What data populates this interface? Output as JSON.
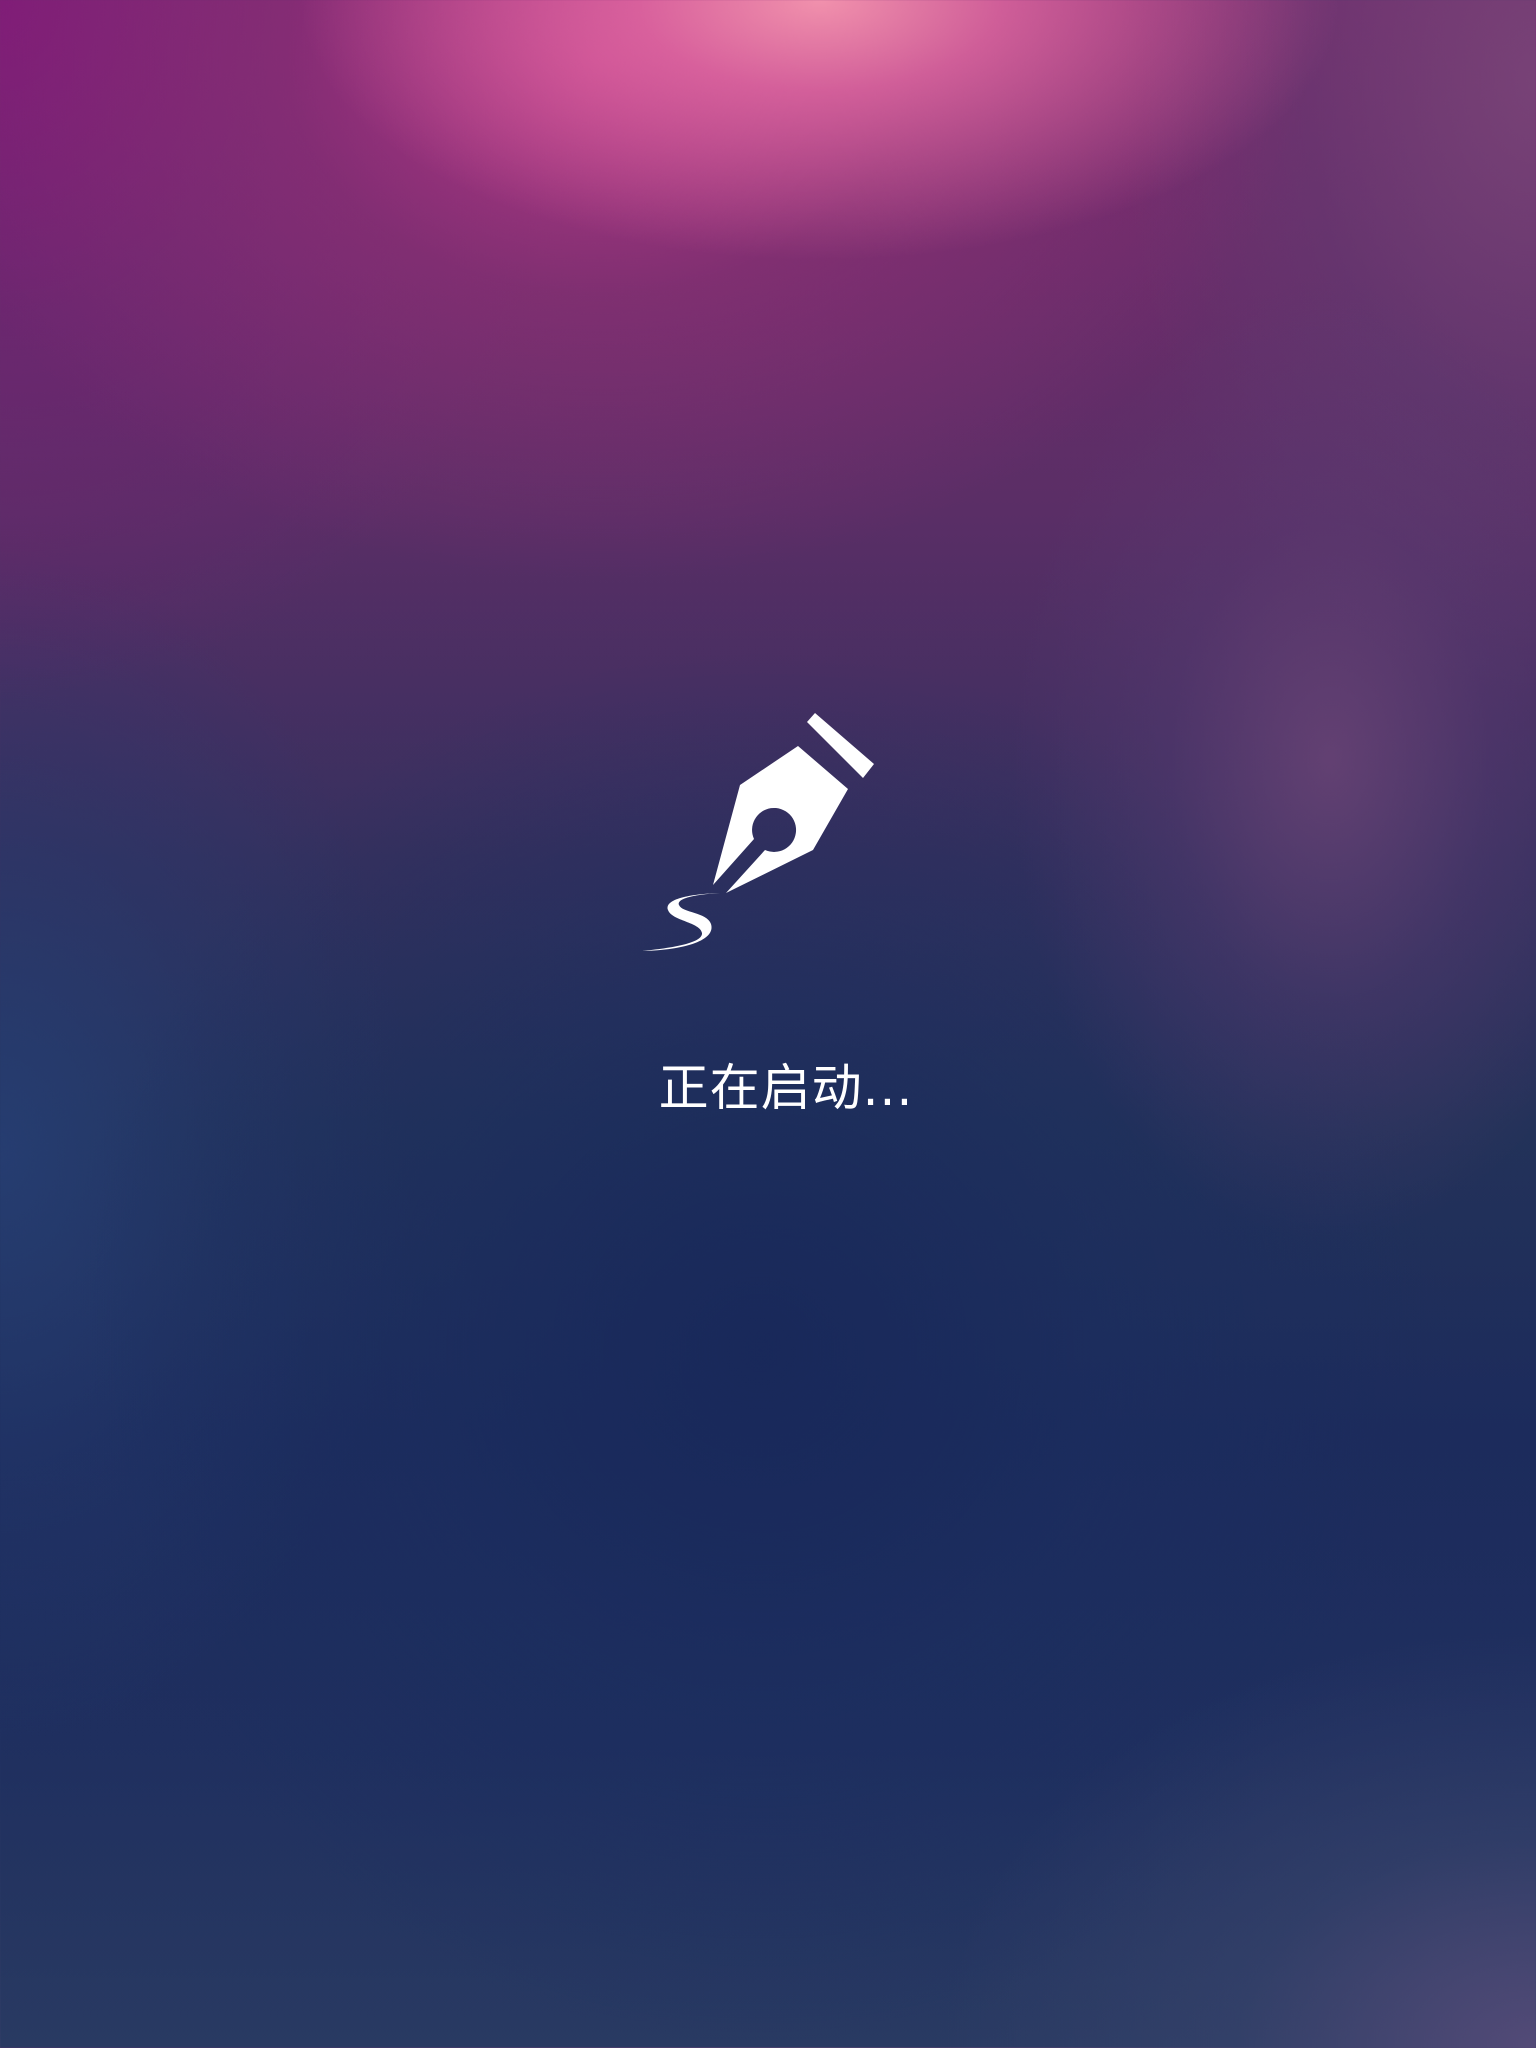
{
  "splash": {
    "icon": "fountain-pen-icon",
    "status_text": "正在启动...",
    "text_color": "#ffffff"
  }
}
